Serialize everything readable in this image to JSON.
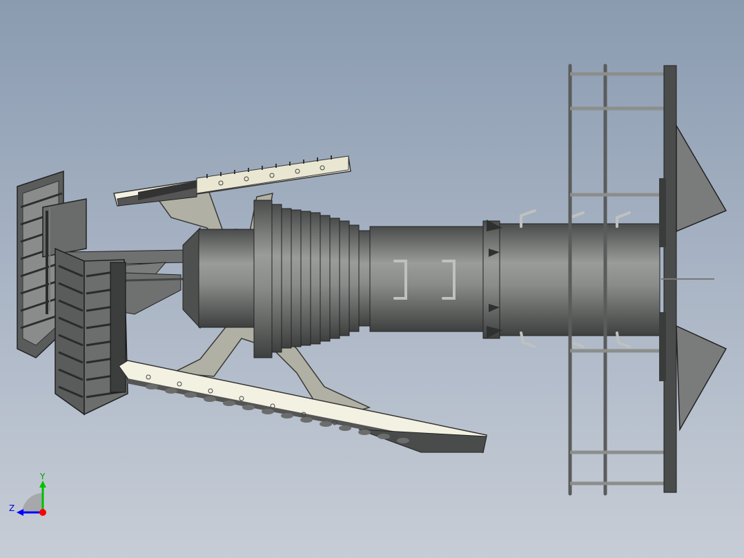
{
  "viewport": {
    "background_top": "#8a9bb0",
    "background_bottom": "#c7cdd6"
  },
  "model": {
    "part_colors": {
      "body": "#7f8180",
      "body_dark": "#4d4f4e",
      "strut": "#a9a99d",
      "rail": "#f0eedd",
      "frame": "#3d3f3e"
    }
  },
  "triad": {
    "y_label": "Y",
    "z_label": "Z",
    "y_color": "#00c000",
    "z_color": "#0000ff",
    "origin_color": "#ff0000"
  }
}
